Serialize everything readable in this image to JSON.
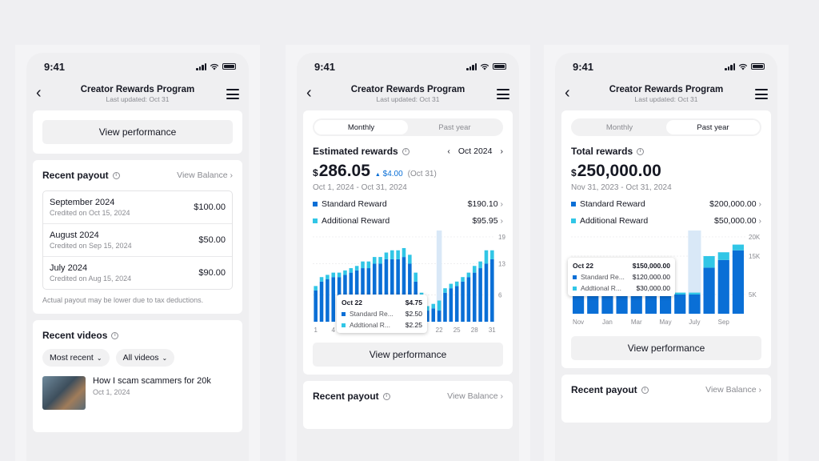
{
  "colors": {
    "standard": "#0a6fd6",
    "additional": "#31c6e6",
    "highlight": "#d9e8f7"
  },
  "status": {
    "time": "9:41"
  },
  "header": {
    "title": "Creator Rewards Program",
    "subtitle": "Last updated: Oct 31"
  },
  "icons": [
    "back-icon",
    "menu-icon",
    "info-icon",
    "chevron-right-icon",
    "chevron-left-icon",
    "chevron-down-icon",
    "arrow-up-icon"
  ],
  "screen1": {
    "view_performance": "View performance",
    "recent_payout": "Recent payout",
    "view_balance": "View Balance",
    "payouts": [
      {
        "month": "September 2024",
        "credited": "Credited on Oct 15, 2024",
        "amount": "$100.00"
      },
      {
        "month": "August 2024",
        "credited": "Credited on Sep 15, 2024",
        "amount": "$50.00"
      },
      {
        "month": "July 2024",
        "credited": "Credited on Aug 15, 2024",
        "amount": "$90.00"
      }
    ],
    "note": "Actual payout may be lower due to tax deductions.",
    "recent_videos": "Recent videos",
    "filter_sort": "Most recent",
    "filter_type": "All videos",
    "video": {
      "title": "How I scam scammers for 20k",
      "date": "Oct 1, 2024"
    }
  },
  "screen2": {
    "tabs": [
      "Monthly",
      "Past year"
    ],
    "active_tab": 0,
    "label": "Estimated rewards",
    "period": "Oct 2024",
    "currency": "$",
    "amount": "286.05",
    "change": "$4.00",
    "change_ref": "(Oct 31)",
    "range": "Oct 1, 2024 - Oct 31, 2024",
    "legend": [
      {
        "name": "Standard Reward",
        "value": "$190.10"
      },
      {
        "name": "Additional Reward",
        "value": "$95.95"
      }
    ],
    "tooltip": {
      "date": "Oct 22",
      "total": "$4.75",
      "rows": [
        {
          "k": "Standard Re...",
          "v": "$2.50"
        },
        {
          "k": "Addtional R...",
          "v": "$2.25"
        }
      ]
    },
    "view_performance": "View performance",
    "recent_payout": "Recent payout",
    "view_balance": "View Balance"
  },
  "screen3": {
    "tabs": [
      "Monthly",
      "Past year"
    ],
    "active_tab": 1,
    "label": "Total rewards",
    "currency": "$",
    "amount": "250,000.00",
    "range": "Nov 31, 2023 - Oct 31, 2024",
    "legend": [
      {
        "name": "Standard Reward",
        "value": "$200,000.00"
      },
      {
        "name": "Additional Reward",
        "value": "$50,000.00"
      }
    ],
    "tooltip": {
      "date": "Oct 22",
      "total": "$150,000.00",
      "rows": [
        {
          "k": "Standard Re...",
          "v": "$120,000.00"
        },
        {
          "k": "Addtional R...",
          "v": "$30,000.00"
        }
      ]
    },
    "view_performance": "View performance",
    "recent_payout": "Recent payout",
    "view_balance": "View Balance"
  },
  "chart_data": [
    {
      "type": "bar",
      "stacked": true,
      "x": [
        1,
        2,
        3,
        4,
        5,
        6,
        7,
        8,
        9,
        10,
        11,
        12,
        13,
        14,
        15,
        16,
        17,
        18,
        19,
        20,
        21,
        22,
        23,
        24,
        25,
        26,
        27,
        28,
        29,
        30,
        31
      ],
      "x_tick_labels": [
        "1",
        "4",
        "7",
        "10",
        "13",
        "16",
        "19",
        "22",
        "25",
        "28",
        "31"
      ],
      "y_tick_labels": [
        "6",
        "13",
        "19"
      ],
      "ylim": [
        0,
        19
      ],
      "highlight_x": 22,
      "series": [
        {
          "name": "Standard Reward",
          "values": [
            7,
            9,
            9.5,
            10,
            10,
            10.5,
            11,
            11.5,
            12,
            12,
            13,
            13,
            14,
            14,
            14,
            14.5,
            13,
            9,
            5,
            2.5,
            3,
            2.5,
            6.5,
            7.5,
            8,
            9,
            10,
            11,
            12,
            13,
            14
          ]
        },
        {
          "name": "Additional Reward",
          "values": [
            1,
            1,
            1,
            1,
            1,
            1,
            1,
            1,
            1.5,
            1.5,
            1.5,
            1.5,
            1.5,
            2,
            2,
            2,
            2,
            2,
            1.5,
            1,
            1,
            2.25,
            1,
            1,
            1,
            1,
            1,
            1.5,
            1.5,
            3,
            2
          ]
        }
      ]
    },
    {
      "type": "bar",
      "stacked": true,
      "categories": [
        "Nov",
        "Dec",
        "Jan",
        "Feb",
        "Mar",
        "Apr",
        "May",
        "Jun",
        "July",
        "Aug",
        "Sep",
        "Oct"
      ],
      "x_tick_labels": [
        "Nov",
        "Jan",
        "Mar",
        "May",
        "July",
        "Sep"
      ],
      "y_tick_labels": [
        "5K",
        "15K",
        "20K"
      ],
      "ylim": [
        0,
        20000
      ],
      "highlight_index": 8,
      "series": [
        {
          "name": "Standard Reward",
          "values": [
            6000,
            6000,
            6000,
            6000,
            6000,
            6000,
            5000,
            5000,
            5000,
            12000,
            14000,
            16500
          ]
        },
        {
          "name": "Additional Reward",
          "values": [
            500,
            500,
            500,
            500,
            500,
            500,
            500,
            500,
            500,
            3000,
            2000,
            1500
          ]
        }
      ]
    }
  ]
}
